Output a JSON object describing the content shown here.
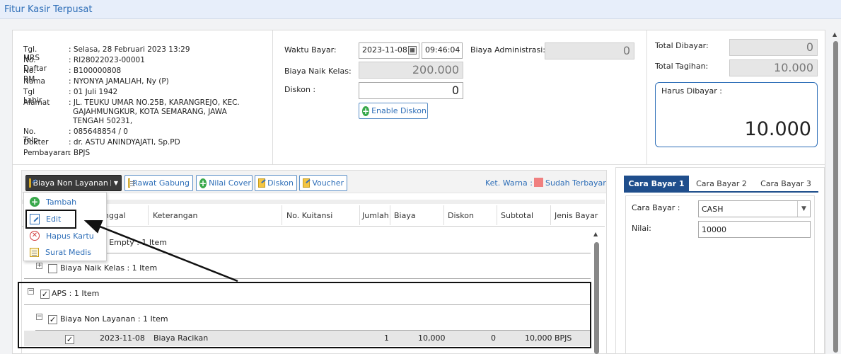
{
  "app_title": "Fitur Kasir Terpusat",
  "patient": {
    "rows": [
      {
        "label": "Tgl. MRS",
        "value": ": Selasa, 28 Februari 2023 13:29"
      },
      {
        "label": "No. Daftar",
        "value": ": RI28022023-00001"
      },
      {
        "label": "No. RM",
        "value": ": B100000808"
      },
      {
        "label": "Nama",
        "value": ": NYONYA JAMALIAH, Ny (P)"
      },
      {
        "label": "Tgl Lahir",
        "value": ": 01 Juli 1942"
      },
      {
        "label": "Alamat",
        "value": ": JL. TEUKU UMAR NO.25B, KARANGREJO, KEC."
      },
      {
        "label": "",
        "value": "GAJAHMUNGKUR, KOTA SEMARANG, JAWA"
      },
      {
        "label": "",
        "value": "TENGAH 50231,"
      },
      {
        "label": "No. Telp",
        "value": ": 085648854 / 0"
      },
      {
        "label": "Dokter",
        "value": ": dr. ASTU ANINDYAJATI, Sp.PD"
      },
      {
        "label": "Pembayaran",
        "value": ": BPJS"
      }
    ]
  },
  "payment": {
    "waktu_bayar_label": "Waktu Bayar:",
    "waktu_bayar_date": "2023-11-08",
    "waktu_bayar_time": "09:46:04",
    "biaya_admin_label": "Biaya Administrasi:",
    "biaya_admin_value": "0",
    "biaya_naik_kelas_label": "Biaya Naik Kelas:",
    "biaya_naik_kelas_value": "200.000",
    "diskon_label": "Diskon :",
    "diskon_value": "0",
    "enable_diskon_label": "Enable Diskon"
  },
  "totals": {
    "total_dibayar_label": "Total Dibayar:",
    "total_dibayar_value": "0",
    "total_tagihan_label": "Total Tagihan:",
    "total_tagihan_value": "10.000",
    "harus_dibayar_label": "Harus Dibayar :",
    "harus_dibayar_value": "10.000"
  },
  "toolbar": {
    "biaya_non_layanan": "Biaya Non Layanan",
    "rawat_gabung": "Rawat Gabung",
    "nilai_cover": "Nilai Cover",
    "diskon": "Diskon",
    "voucher": "Voucher",
    "ket_warna": "Ket. Warna :",
    "sudah_terbayar": "Sudah Terbayar",
    "sudah_terbayar_color": "#f08080"
  },
  "menu": {
    "tambah": "Tambah",
    "edit": "Edit",
    "hapus_kartu": "Hapus Kartu",
    "surat_medis": "Surat Medis"
  },
  "grid": {
    "columns": [
      "nggal",
      "Keterangan",
      "No. Kuitansi",
      "Jumlah",
      "Biaya",
      "Diskon",
      "Subtotal",
      "Jenis Bayar"
    ],
    "group_empty": "s Empty : 1 Item",
    "group_naik_kelas": "Biaya Naik Kelas : 1 Item",
    "group_aps": "APS : 1 Item",
    "group_non_layanan": "Biaya Non Layanan : 1 Item",
    "row": {
      "tanggal": "2023-11-08",
      "keterangan": "Biaya Racikan",
      "jumlah": "1",
      "biaya": "10,000",
      "diskon": "0",
      "subtotal": "10,000",
      "jenis_bayar": "BPJS"
    }
  },
  "cara_bayar": {
    "tabs": [
      "Cara Bayar 1",
      "Cara Bayar 2",
      "Cara Bayar 3"
    ],
    "cara_bayar_label": "Cara Bayar :",
    "cara_bayar_value": "CASH",
    "nilai_label": "Nilai:",
    "nilai_value": "10000"
  },
  "colors": {
    "accent": "#2f6fb8",
    "active_tab": "#1f4e8c"
  }
}
